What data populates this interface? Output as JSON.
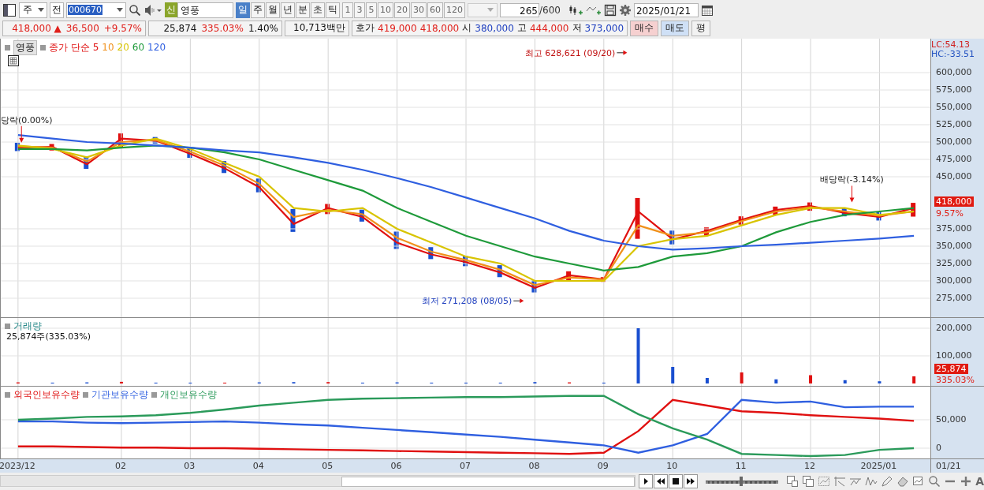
{
  "toolbar": {
    "market": "주",
    "mode": "전",
    "code": "000670",
    "badge": "신",
    "name": "영풍",
    "periods": [
      {
        "label": "일",
        "selected": true
      },
      {
        "label": "주",
        "selected": false
      },
      {
        "label": "월",
        "selected": false
      },
      {
        "label": "년",
        "selected": false
      },
      {
        "label": "분",
        "selected": false
      },
      {
        "label": "초",
        "selected": false
      },
      {
        "label": "틱",
        "selected": false
      }
    ],
    "intervals": [
      "1",
      "3",
      "5",
      "10",
      "20",
      "30",
      "60",
      "120"
    ],
    "count": "265",
    "count_max": "/600",
    "date": "2025/01/21"
  },
  "quote_bar": {
    "groups": [
      [
        {
          "text": "418,000 ▲",
          "color": "#e0201b"
        },
        {
          "text": "36,500",
          "color": "#e0201b"
        },
        {
          "text": "+9.57%",
          "color": "#e0201b"
        }
      ],
      [
        {
          "text": "25,874"
        },
        {
          "text": "335.03%",
          "color": "#e0201b"
        },
        {
          "text": "1.40%"
        }
      ],
      [
        {
          "text": "10,713백만"
        }
      ],
      [
        {
          "text": "호가"
        },
        {
          "text": "419,000",
          "color": "#e0201b"
        },
        {
          "text": "418,000",
          "color": "#e0201b"
        },
        {
          "text": "시"
        },
        {
          "text": "380,000",
          "color": "#1f3fbf"
        },
        {
          "text": "고"
        },
        {
          "text": "444,000",
          "color": "#e0201b"
        },
        {
          "text": "저"
        },
        {
          "text": "373,000",
          "color": "#1f3fbf"
        }
      ]
    ],
    "buttons": [
      {
        "label": "매수",
        "kind": "buy"
      },
      {
        "label": "매도",
        "kind": "sell"
      },
      {
        "label": "평",
        "kind": "plain"
      }
    ]
  },
  "price_pane": {
    "stock_label": "영풍",
    "lc": "LC:54.13",
    "hc": "HC:-33.51",
    "price_tag": "418,000",
    "change_tag": "9.57%",
    "chart_data": {
      "type": "line",
      "grid": true,
      "ylim": [
        247700,
        648900
      ],
      "yticks": [
        {
          "value": 600000,
          "label": "600,000"
        },
        {
          "value": 575000,
          "label": "575,000"
        },
        {
          "value": 550000,
          "label": "550,000"
        },
        {
          "value": 525000,
          "label": "525,000"
        },
        {
          "value": 500000,
          "label": "500,000"
        },
        {
          "value": 475000,
          "label": "475,000"
        },
        {
          "value": 450000,
          "label": "450,000"
        },
        {
          "value": 375000,
          "label": "375,000"
        },
        {
          "value": 350000,
          "label": "350,000"
        },
        {
          "value": 325000,
          "label": "325,000"
        },
        {
          "value": 300000,
          "label": "300,000"
        },
        {
          "value": 275000,
          "label": "275,000"
        }
      ],
      "series": [
        {
          "name": "종가 단순 5",
          "color": "#e01010",
          "values": [
            492000,
            493000,
            468000,
            505000,
            502000,
            483000,
            462000,
            435000,
            382000,
            405000,
            392000,
            355000,
            338000,
            327000,
            312000,
            290000,
            308000,
            302000,
            400000,
            360000,
            372000,
            388000,
            402000,
            408000,
            398000,
            392000,
            405000
          ]
        },
        {
          "name": "10",
          "color": "#f0901a",
          "values": [
            494000,
            492000,
            472000,
            500000,
            503000,
            486000,
            466000,
            440000,
            392000,
            402000,
            396000,
            362000,
            342000,
            330000,
            316000,
            294000,
            305000,
            302000,
            380000,
            365000,
            370000,
            386000,
            400000,
            406000,
            400000,
            394000,
            400000
          ]
        },
        {
          "name": "20",
          "color": "#d8c400",
          "values": [
            495000,
            490000,
            478000,
            495000,
            505000,
            490000,
            470000,
            450000,
            405000,
            400000,
            405000,
            375000,
            355000,
            335000,
            325000,
            300000,
            300000,
            300000,
            350000,
            360000,
            365000,
            380000,
            395000,
            405000,
            405000,
            395000,
            400000
          ]
        },
        {
          "name": "60",
          "color": "#1e9a3a",
          "values": [
            490000,
            490000,
            488000,
            492000,
            495000,
            492000,
            485000,
            475000,
            460000,
            445000,
            430000,
            405000,
            385000,
            365000,
            350000,
            335000,
            325000,
            315000,
            320000,
            335000,
            340000,
            350000,
            370000,
            385000,
            395000,
            400000,
            405000
          ]
        },
        {
          "name": "120",
          "color": "#2f5fe0",
          "values": [
            510000,
            505000,
            500000,
            498000,
            495000,
            492000,
            488000,
            485000,
            478000,
            470000,
            460000,
            448000,
            435000,
            420000,
            405000,
            390000,
            372000,
            358000,
            350000,
            345000,
            347000,
            350000,
            352000,
            355000,
            358000,
            361000,
            365000
          ]
        }
      ],
      "annotations": [
        "당락(0.00%)",
        "최고 628,621 (09/20)",
        "최저 271,208 (08/05)",
        "배당락(-3.14%)"
      ]
    }
  },
  "volume_pane": {
    "readout": "25,874주(335.03%)",
    "value_tag": "25,874",
    "ratio_tag": "335.03%",
    "chart_data": {
      "type": "bar",
      "title": "거래량",
      "grid": true,
      "ylim": [
        -8600,
        237100
      ],
      "yticks": [
        {
          "value": 200000,
          "label": "200,000"
        },
        {
          "value": 100000,
          "label": "100,000"
        }
      ],
      "series": [
        {
          "color": "#e01010",
          "values": [
            4000,
            null,
            null,
            6000,
            null,
            null,
            3000,
            null,
            null,
            5000,
            null,
            null,
            null,
            null,
            null,
            null,
            4000,
            null,
            null,
            null,
            null,
            40000,
            null,
            30000,
            null,
            null,
            26000
          ]
        },
        {
          "color": "#1a4fd0",
          "values": [
            null,
            3000,
            4000,
            null,
            3000,
            3000,
            null,
            4000,
            5000,
            null,
            3000,
            4000,
            3000,
            3000,
            3000,
            5000,
            null,
            3000,
            200000,
            60000,
            20000,
            null,
            15000,
            null,
            12000,
            8000,
            null
          ]
        }
      ]
    }
  },
  "holdings_pane": {
    "chart_data": {
      "type": "line",
      "grid": true,
      "ylim": [
        -18100,
        108300
      ],
      "categories": [
        "2023/12",
        null,
        null,
        "02",
        null,
        "03",
        null,
        "04",
        null,
        "05",
        null,
        "06",
        null,
        "07",
        null,
        "08",
        null,
        "09",
        null,
        "10",
        null,
        "11",
        null,
        "12",
        null,
        "2025/01",
        null
      ],
      "yticks": [
        {
          "value": 50000,
          "label": "50,000"
        },
        {
          "value": 0,
          "label": "0"
        }
      ],
      "series": [
        {
          "name": "외국인보유수량",
          "color": "#e01010",
          "values": [
            3000,
            3000,
            2000,
            1000,
            1000,
            0,
            0,
            -1000,
            -2000,
            -3000,
            -4000,
            -5000,
            -6000,
            -7000,
            -8000,
            -9000,
            -10000,
            -8000,
            30000,
            85000,
            75000,
            65000,
            62000,
            58000,
            55000,
            52000,
            48000
          ]
        },
        {
          "name": "기관보유수량",
          "color": "#2f5fe0",
          "values": [
            47000,
            47000,
            45000,
            44000,
            45000,
            46000,
            47000,
            45000,
            42000,
            40000,
            36000,
            32000,
            28000,
            24000,
            20000,
            15000,
            10000,
            5000,
            -8000,
            5000,
            25000,
            85000,
            80000,
            82000,
            72000,
            73000,
            73000
          ]
        },
        {
          "name": "개인보유수량",
          "color": "#2a9a5a",
          "values": [
            50000,
            52000,
            55000,
            56000,
            58000,
            62000,
            68000,
            75000,
            80000,
            85000,
            87000,
            88000,
            89000,
            90000,
            90000,
            91000,
            92000,
            92000,
            60000,
            35000,
            15000,
            -10000,
            -12000,
            -14000,
            -12000,
            -3000,
            0
          ]
        }
      ]
    }
  },
  "x_axis": {
    "end_label": "01/21"
  },
  "bottom_bar": {
    "zoom_slider": {
      "level": 0.45
    },
    "font_button": "A"
  }
}
